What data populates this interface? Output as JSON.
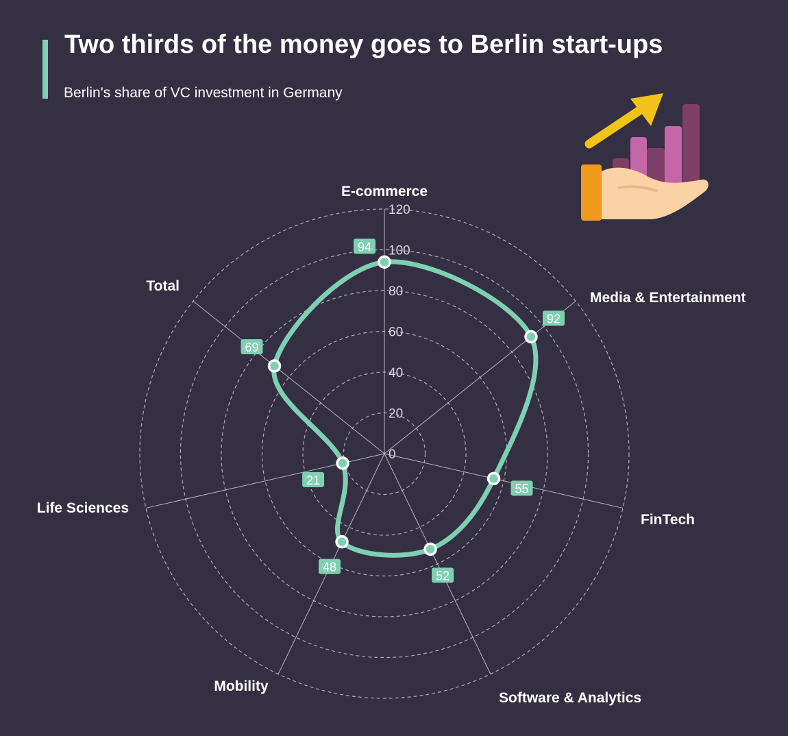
{
  "header": {
    "title": "Two thirds of the money goes to Berlin start-ups",
    "subtitle": "Berlin's share of VC investment in Germany"
  },
  "colors": {
    "background": "#342f43",
    "accent": "#7fd0b2",
    "grid": "#c9c6d0",
    "label_text": "#ffffff",
    "tick_text": "#d8d6dd"
  },
  "illustration": {
    "icon": "hand-holding-growth-chart-icon"
  },
  "chart_data": {
    "type": "radar",
    "categories": [
      "E-commerce",
      "Media & Entertainment",
      "FinTech",
      "Software & Analytics",
      "Mobility",
      "Life Sciences",
      "Total"
    ],
    "values": [
      94,
      92,
      55,
      52,
      48,
      21,
      69
    ],
    "data_labels": [
      "94",
      "92",
      "55",
      "52",
      "48",
      "21",
      "69"
    ],
    "radial_ticks": [
      0,
      20,
      40,
      60,
      80,
      100,
      120
    ],
    "radial_tick_labels": [
      "0",
      "20",
      "40",
      "60",
      "80",
      "100",
      "120"
    ],
    "rmin": 0,
    "rmax": 120,
    "grid": "dashed-circles"
  }
}
